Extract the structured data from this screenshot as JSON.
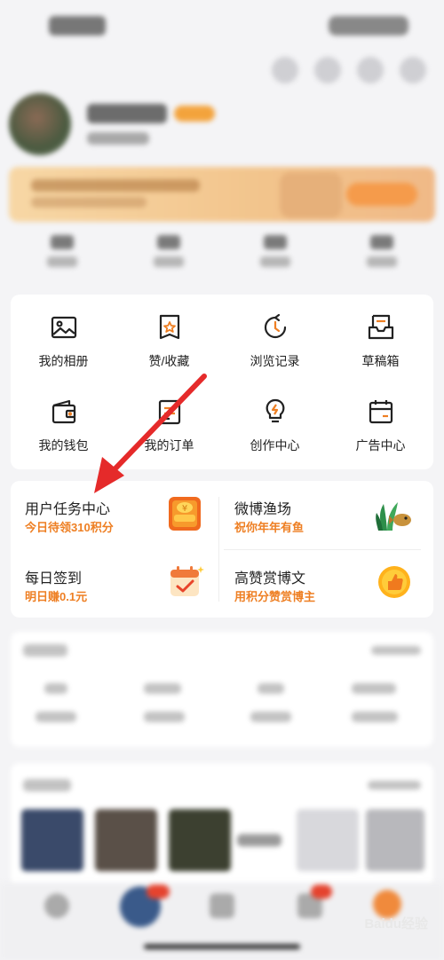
{
  "grid": {
    "items": [
      {
        "label": "我的相册",
        "icon": "photo-album-icon"
      },
      {
        "label": "赞/收藏",
        "icon": "bookmark-star-icon"
      },
      {
        "label": "浏览记录",
        "icon": "history-clock-icon"
      },
      {
        "label": "草稿箱",
        "icon": "draft-box-icon"
      },
      {
        "label": "我的钱包",
        "icon": "wallet-icon"
      },
      {
        "label": "我的订单",
        "icon": "order-list-icon"
      },
      {
        "label": "创作中心",
        "icon": "lightbulb-icon"
      },
      {
        "label": "广告中心",
        "icon": "calendar-ad-icon"
      }
    ]
  },
  "tasks": {
    "user_task": {
      "title": "用户任务中心",
      "subtitle": "今日待领310积分",
      "icon": "coin-stack-icon"
    },
    "fishery": {
      "title": "微博渔场",
      "subtitle": "祝你年年有鱼",
      "icon": "fish-plant-icon"
    },
    "checkin": {
      "title": "每日签到",
      "subtitle": "明日赚0.1元",
      "icon": "calendar-check-icon"
    },
    "reward": {
      "title": "高赞赏博文",
      "subtitle": "用积分赞赏博主",
      "icon": "thumb-coin-icon"
    }
  },
  "colors": {
    "accent": "#ee7f23",
    "arrow": "#e52a2a",
    "card_bg": "#ffffff",
    "page_bg": "#f4f4f6"
  },
  "watermark": "Baidu经验"
}
